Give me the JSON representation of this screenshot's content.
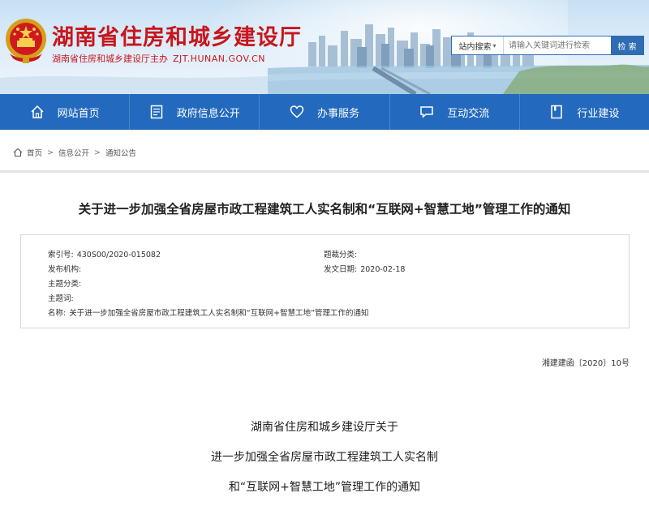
{
  "header": {
    "site_title": "湖南省住房和城乡建设厅",
    "site_sub": "湖南省住房和城乡建设厅主办",
    "site_domain": "ZJT.HUNAN.GOV.CN",
    "brand_color": "#c8161d"
  },
  "search": {
    "scope_label": "站内搜索",
    "placeholder": "请输入关键词进行检索",
    "button_label": "检 索"
  },
  "nav": {
    "color": "#2369bd",
    "items": [
      {
        "label": "网站首页",
        "icon": "home-icon"
      },
      {
        "label": "政府信息公开",
        "icon": "document-icon"
      },
      {
        "label": "办事服务",
        "icon": "heart-icon"
      },
      {
        "label": "互动交流",
        "icon": "chat-icon"
      },
      {
        "label": "行业建设",
        "icon": "book-icon"
      }
    ]
  },
  "breadcrumb": {
    "items": [
      "首页",
      "信息公开",
      "通知公告"
    ],
    "separator": ">"
  },
  "article": {
    "title": "关于进一步加强全省房屋市政工程建筑工人实名制和“互联网+智慧工地”管理工作的通知",
    "meta": {
      "index_label": "索引号:",
      "index_value": "430S00/2020-015082",
      "category_label": "题裁分类:",
      "category_value": "",
      "publisher_label": "发布机构:",
      "publisher_value": "",
      "date_label": "发文日期:",
      "date_value": "2020-02-18",
      "topic_label": "主题分类:",
      "topic_value": "",
      "keywords_label": "主题词:",
      "keywords_value": "",
      "name_label": "名称:",
      "name_value": "关于进一步加强全省房屋市政工程建筑工人实名制和“互联网+智慧工地”管理工作的通知"
    },
    "doc_number": "湘建建函〔2020〕10号",
    "body_heading": [
      "湖南省住房和城乡建设厅关于",
      "进一步加强全省房屋市政工程建筑工人实名制",
      "和“互联网+智慧工地”管理工作的通知"
    ]
  }
}
